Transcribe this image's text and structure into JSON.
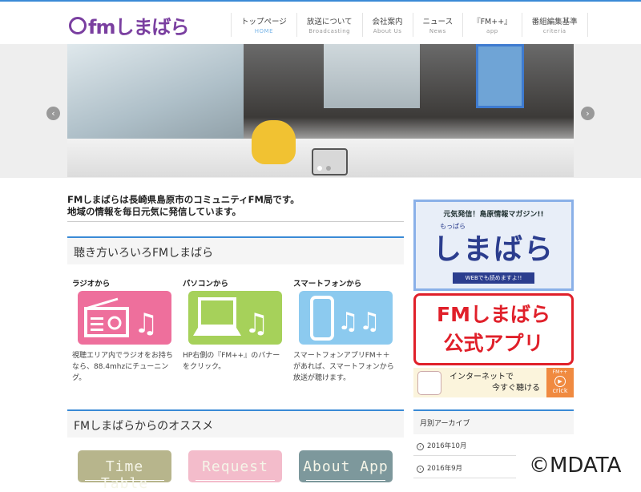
{
  "logo": {
    "text": "fmしまばら"
  },
  "nav": [
    {
      "ja": "トップページ",
      "en": "HOME"
    },
    {
      "ja": "放送について",
      "en": "Broadcasting"
    },
    {
      "ja": "会社案内",
      "en": "About Us"
    },
    {
      "ja": "ニュース",
      "en": "News"
    },
    {
      "ja": "『FM++』",
      "en": "app"
    },
    {
      "ja": "番組編集基準",
      "en": "criteria"
    }
  ],
  "slider": {
    "prev": "‹",
    "next": "›"
  },
  "intro": {
    "line1": "FMしまばらは長崎県島原市のコミュニティFM局です。",
    "line2": "地域の情報を毎日元気に発信しています。"
  },
  "listen": {
    "title": "聴き方いろいろFMしまばら",
    "cols": [
      {
        "label": "ラジオから",
        "desc": "視聴エリア内でラジオをお持ちなら、88.4mhzにチューニング。",
        "color": "#ee6f9c"
      },
      {
        "label": "パソコンから",
        "desc": "HP右側の『FM++』のバナーをクリック。",
        "color": "#a6d15a"
      },
      {
        "label": "スマートフォンから",
        "desc": "スマートフォンアプリFM＋＋があれば、スマートフォンから放送が聴けます。",
        "color": "#8ccaef"
      }
    ]
  },
  "recommend": {
    "title": "FMしまばらからのオススメ",
    "buttons": [
      {
        "label": "Time Table",
        "color": "#b7b58c"
      },
      {
        "label": "Request",
        "color": "#f3bccb"
      },
      {
        "label": "About App",
        "color": "#7d989c"
      }
    ]
  },
  "sidebar": {
    "magazine": {
      "top": "元気発信！島原情報マガジン!!",
      "title": "しまばら",
      "small": "もっぱら",
      "sub": "WEBでも読めますよ!!"
    },
    "app": {
      "line1": "FMしまばら",
      "line2": "公式アプリ"
    },
    "net": {
      "line1": "インターネットで",
      "line2": "今すぐ聴ける",
      "badge": "FM++",
      "crick": "crick"
    },
    "archive": {
      "title": "月別アーカイブ",
      "items": [
        "2016年10月",
        "2016年9月"
      ]
    }
  },
  "watermark": "©MDATA"
}
